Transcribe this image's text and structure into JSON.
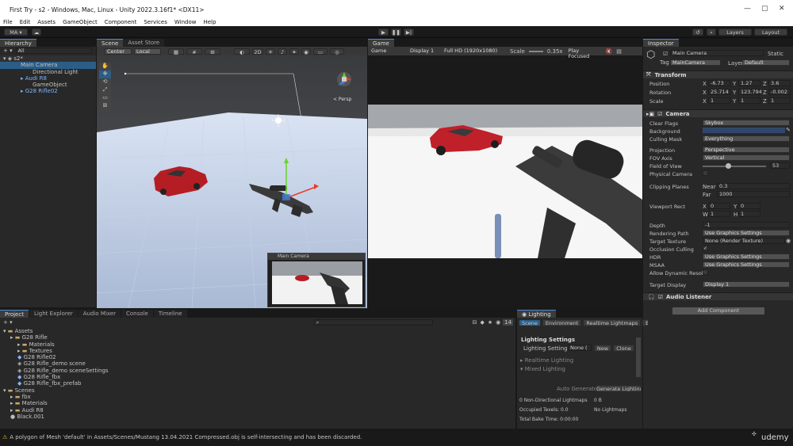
{
  "window": {
    "title": "First Try - s2 - Windows, Mac, Linux - Unity 2022.3.16f1* <DX11>",
    "minimize": "—",
    "maximize": "▢",
    "close": "✕"
  },
  "menu": [
    "File",
    "Edit",
    "Assets",
    "GameObject",
    "Component",
    "Services",
    "Window",
    "Help"
  ],
  "toolbar": {
    "account": "MA ▾",
    "layers": "Layers",
    "layout": "Layout"
  },
  "hierarchy": {
    "tab": "Hierarchy",
    "search": "All",
    "scene": "s2*",
    "items": [
      "Main Camera",
      "Directional Light",
      "Audi R8",
      "GameObject",
      "G28 Rifle02"
    ]
  },
  "scene": {
    "tabs": [
      "Scene",
      "Asset Store"
    ],
    "pivot": "Center",
    "space": "Local",
    "twod": "2D",
    "persp": "< Persp",
    "preview_title": "Main Camera"
  },
  "game": {
    "tab": "Game",
    "mode": "Game",
    "display": "Display 1",
    "resolution": "Full HD (1920x1080)",
    "scale_label": "Scale",
    "scale_value": "0.35x",
    "play_focused": "Play Focused"
  },
  "inspector": {
    "tab": "Inspector",
    "object_name": "Main Camera",
    "static": "Static",
    "tag_label": "Tag",
    "tag": "MainCamera",
    "layer_label": "Layer",
    "layer": "Default",
    "transform": {
      "title": "Transform",
      "rows": [
        {
          "label": "Position",
          "x": "-6.73",
          "y": "1.27",
          "z": "3.6"
        },
        {
          "label": "Rotation",
          "x": "25.714",
          "y": "123.794",
          "z": "-0.002"
        },
        {
          "label": "Scale",
          "x": "1",
          "y": "1",
          "z": "1"
        }
      ]
    },
    "camera": {
      "title": "Camera",
      "clear_flags_label": "Clear Flags",
      "clear_flags": "Skybox",
      "background_label": "Background",
      "culling_label": "Culling Mask",
      "culling": "Everything",
      "projection_label": "Projection",
      "projection": "Perspective",
      "fov_axis_label": "FOV Axis",
      "fov_axis": "Vertical",
      "fov_label": "Field of View",
      "fov": "53",
      "fov_fraction": 0.4,
      "physical_label": "Physical Camera",
      "clipping_label": "Clipping Planes",
      "near_label": "Near",
      "near": "0.3",
      "far_label": "Far",
      "far": "1000",
      "viewport_label": "Viewport Rect",
      "vx": "0",
      "vy": "0",
      "vw": "1",
      "vh": "1",
      "depth_label": "Depth",
      "depth": "-1",
      "render_path_label": "Rendering Path",
      "render_path": "Use Graphics Settings",
      "target_texture_label": "Target Texture",
      "target_texture": "None (Render Texture)",
      "occlusion_label": "Occlusion Culling",
      "hdr_label": "HDR",
      "hdr": "Use Graphics Settings",
      "msaa_label": "MSAA",
      "msaa": "Use Graphics Settings",
      "dynamic_label": "Allow Dynamic Resolu",
      "target_display_label": "Target Display",
      "target_display": "Display 1"
    },
    "audio_listener": "Audio Listener",
    "add_component": "Add Component"
  },
  "project": {
    "tabs": [
      "Project",
      "Light Explorer",
      "Audio Mixer",
      "Console",
      "Timeline"
    ],
    "count": "14",
    "tree": [
      {
        "t": "Assets",
        "d": 0,
        "k": "folder"
      },
      {
        "t": "G28 Rifle",
        "d": 1,
        "k": "folder"
      },
      {
        "t": "Materials",
        "d": 2,
        "k": "folder"
      },
      {
        "t": "Textures",
        "d": 2,
        "k": "folder"
      },
      {
        "t": "G28 Rifle02",
        "d": 2,
        "k": "prefab"
      },
      {
        "t": "G28 Rifle_demo scene",
        "d": 2,
        "k": "scene"
      },
      {
        "t": "G28 Rifle_demo sceneSettings",
        "d": 2,
        "k": "scene"
      },
      {
        "t": "G28 Rifle_fbx",
        "d": 2,
        "k": "prefab"
      },
      {
        "t": "G28 Rifle_fbx_prefab",
        "d": 2,
        "k": "prefab"
      },
      {
        "t": "Scenes",
        "d": 0,
        "k": "folder"
      },
      {
        "t": "fbx",
        "d": 1,
        "k": "folder"
      },
      {
        "t": "Materials",
        "d": 1,
        "k": "folder"
      },
      {
        "t": "Audi R8",
        "d": 1,
        "k": "folder"
      },
      {
        "t": "Black.001",
        "d": 1,
        "k": "file"
      }
    ]
  },
  "lighting": {
    "tab": "Lighting",
    "subtabs": [
      "Scene",
      "Environment",
      "Realtime Lightmaps",
      "Baked"
    ],
    "settings_title": "Lighting Settings",
    "settings_label": "Lighting Settings A",
    "settings_value": "None (",
    "new": "New",
    "clone": "Clone",
    "realtime": "Realtime Lighting",
    "mixed": "Mixed Lighting",
    "auto_generate": "Auto Generate",
    "generate": "Generate Lighting",
    "stats": [
      "0 Non-Directional Lightmaps",
      "Occupied Texels: 0.0",
      "Total Bake Time: 0:00:00"
    ],
    "stat_size": "0 B",
    "no_lightmaps": "No Lightmaps"
  },
  "status": {
    "warning": "A polygon of Mesh 'default' in Assets/Scenes/Mustang 13.04.2021 Compressed.obj is self-intersecting and has been discarded.",
    "watermark": "udemy"
  },
  "colors": {
    "accent": "#4a8ad6",
    "selection": "#2c5d87",
    "car": "#c0202a",
    "background_swatch": "#31466a"
  }
}
